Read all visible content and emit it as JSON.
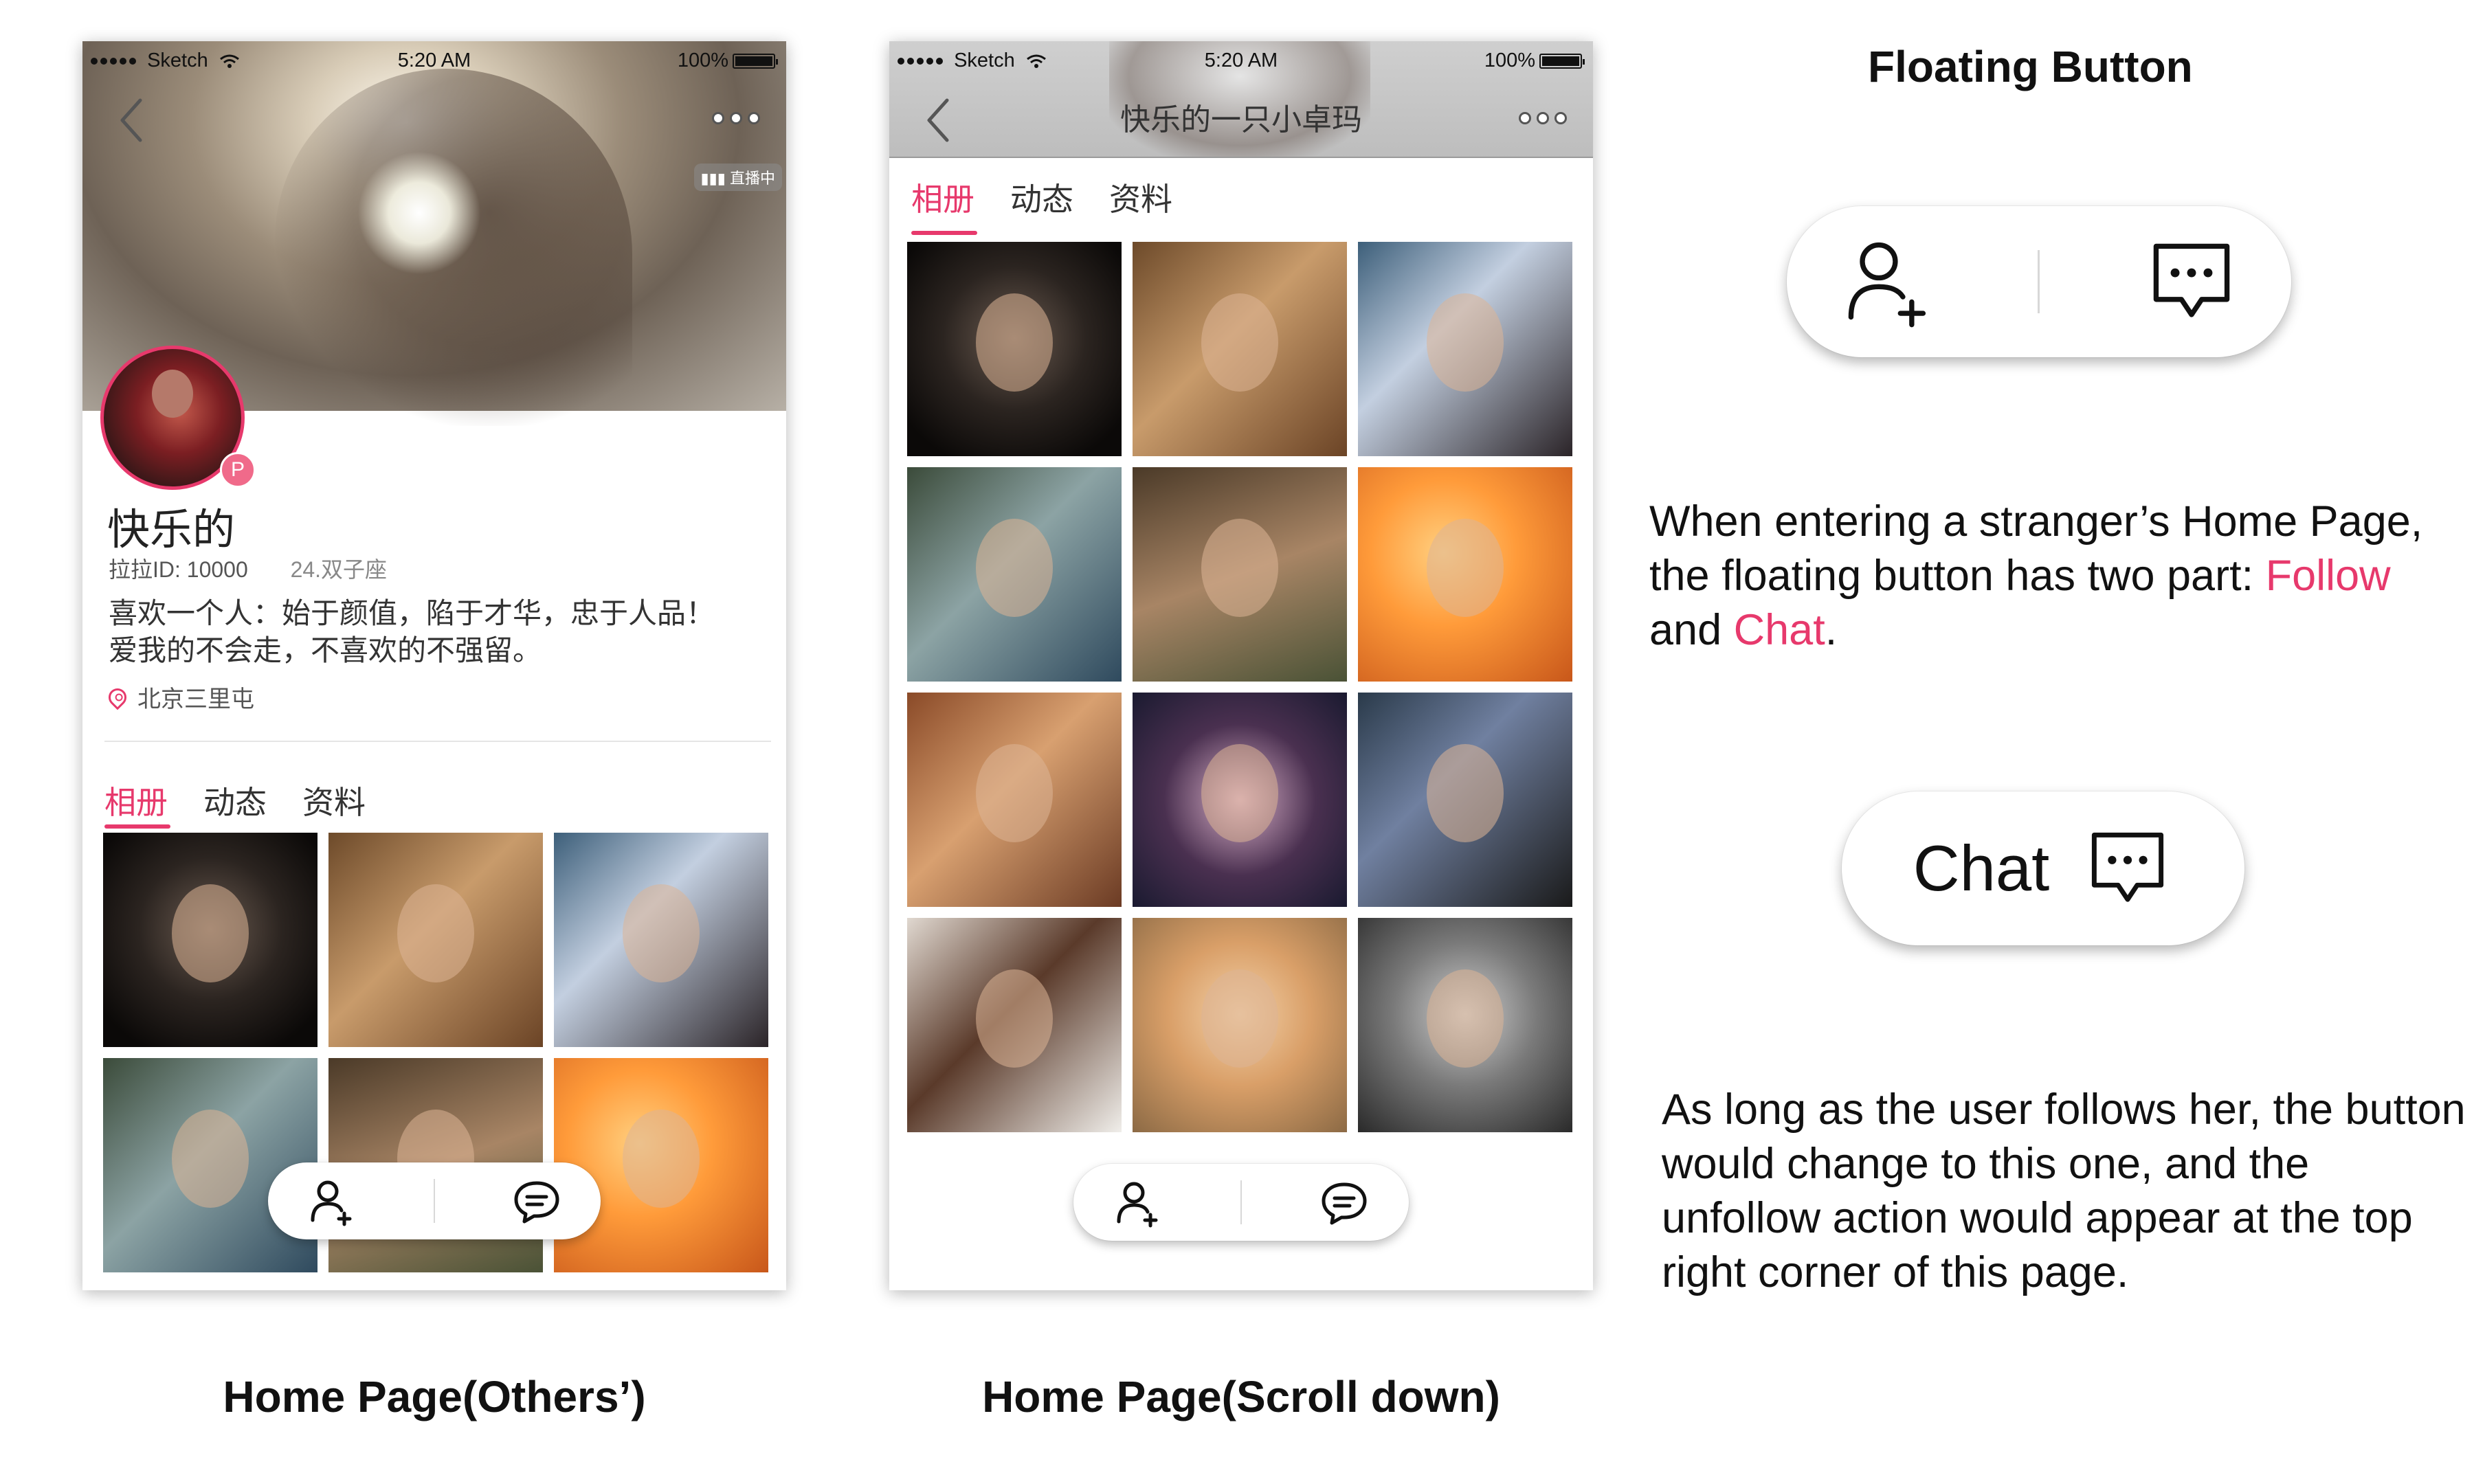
{
  "status_bar": {
    "carrier": "Sketch",
    "time": "5:20 AM",
    "battery": "100%"
  },
  "screen1": {
    "live_badge": "直播中",
    "profile": {
      "badge": "P",
      "name": "快乐的",
      "id_label": "拉拉ID: 10000",
      "age_sign": "24.双子座",
      "bio": "喜欢一个人：始于颜值，陷于才华，忠于人品！爱我的不会走，不喜欢的不强留。",
      "location": "北京三里屯"
    },
    "tabs": [
      {
        "label": "相册"
      },
      {
        "label": "动态"
      },
      {
        "label": "资料"
      }
    ],
    "active_tab": 0,
    "caption": "Home Page(Others’)"
  },
  "screen2": {
    "title": "快乐的一只小卓玛",
    "tabs": [
      {
        "label": "相册"
      },
      {
        "label": "动态"
      },
      {
        "label": "资料"
      }
    ],
    "active_tab": 0,
    "caption": "Home Page(Scroll down)"
  },
  "floating_button": {
    "heading": "Floating Button",
    "desc_part1": "When entering a stranger’s Home Page, the floating button has two part: ",
    "follow_word": "Follow",
    "and_word": " and ",
    "chat_word": "Chat",
    "period": ".",
    "chat_label": "Chat",
    "desc2": "As long as the user follows her, the button would change to this one, and the unfollow action would appear at the top right corner of this page."
  },
  "icons": {
    "back": "chevron-left-icon",
    "more": "more-dots-icon",
    "follow": "add-user-icon",
    "chat": "chat-bubble-icon",
    "location": "location-pin-icon",
    "signal": "signal-dots-icon",
    "wifi": "wifi-icon",
    "battery": "battery-icon"
  },
  "colors": {
    "accent": "#e7396c",
    "badge": "#f06a8a"
  }
}
